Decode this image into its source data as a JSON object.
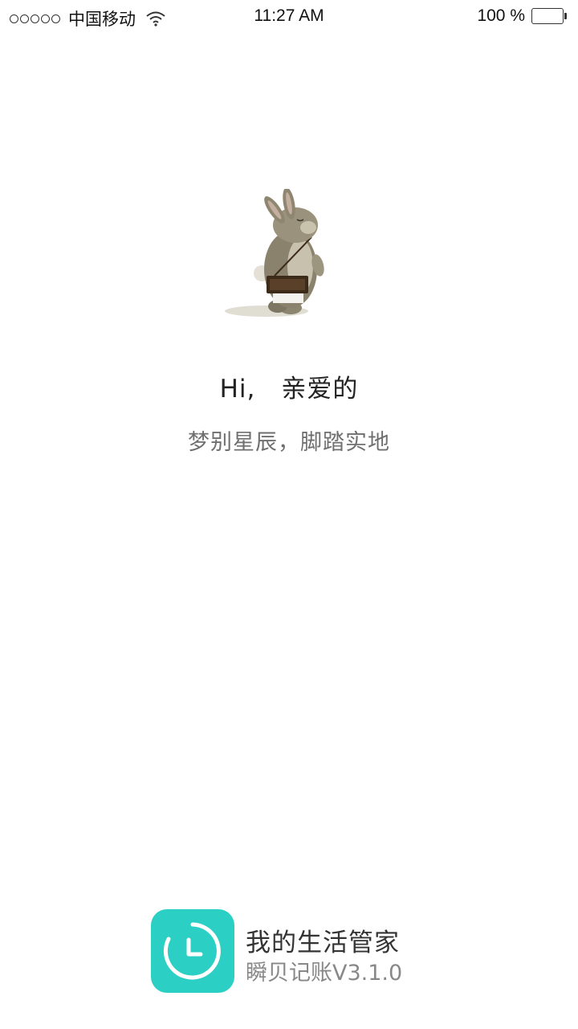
{
  "status_bar": {
    "carrier": "中国移动",
    "time": "11:27 AM",
    "battery": "100 %",
    "signal_icon": "signal-dots-icon",
    "wifi_icon": "wifi-icon",
    "battery_icon": "battery-icon"
  },
  "splash": {
    "illustration": "bunny-illustration",
    "greeting": "Hi,　亲爱的",
    "slogan": "梦别星辰，脚踏实地"
  },
  "branding": {
    "app_icon": "clock-icon",
    "app_name": "我的生活管家",
    "app_version": "瞬贝记账V3.1.0",
    "accent_color": "#2bcfc4"
  }
}
